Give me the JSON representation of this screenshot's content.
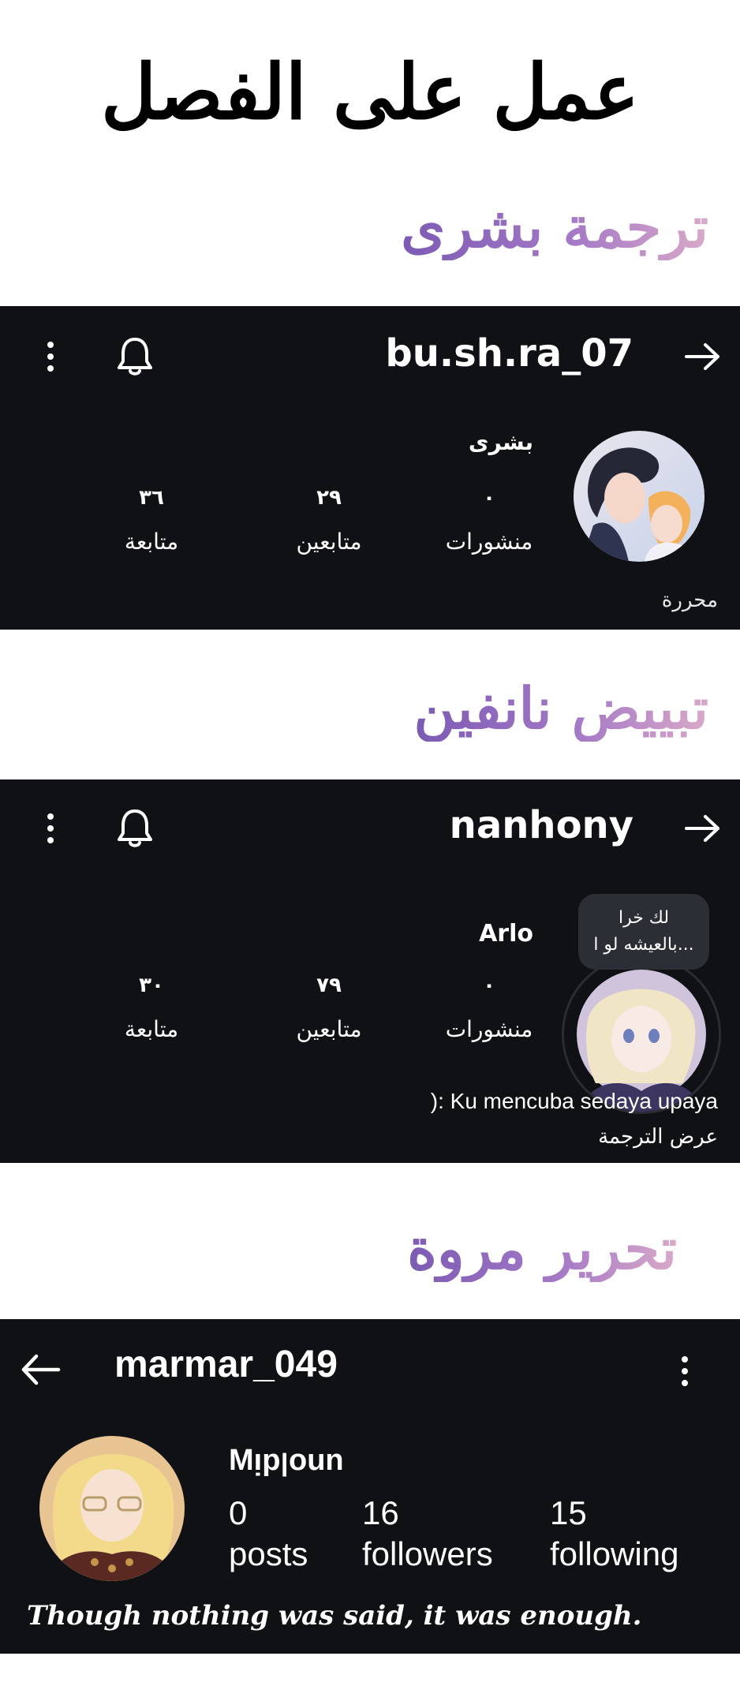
{
  "header": {
    "title": "عمل على الفصل"
  },
  "credits": {
    "translation": "ترجمة بشرى",
    "cleaning": "تبييض نانفين",
    "editing": "تحرير مروة"
  },
  "profile1": {
    "username": "bu.sh.ra_07",
    "display_name": "بشرى",
    "stats": [
      {
        "value": "٠",
        "label": "منشورات"
      },
      {
        "value": "٢٩",
        "label": "متابعين"
      },
      {
        "value": "٣٦",
        "label": "متابعة"
      }
    ],
    "role": "محررة",
    "icons": {
      "back": "arrow-icon",
      "bell": "bell-icon",
      "menu": "more-vertical-icon"
    }
  },
  "profile2": {
    "username": "nanhony",
    "display_name": "Arlo",
    "note_line1": "لك خرا",
    "note_line2": "بالعيشه لو ا...",
    "stats": [
      {
        "value": "٠",
        "label": "منشورات"
      },
      {
        "value": "٧٩",
        "label": "متابعين"
      },
      {
        "value": "٣٠",
        "label": "متابعة"
      }
    ],
    "bio": "): Ku mencuba sedaya upaya",
    "see_translation": "عرض الترجمة"
  },
  "profile3": {
    "username": "marmar_049",
    "display_name": "Mᴉpꞁoun",
    "stats": [
      {
        "value": "0",
        "label": "posts"
      },
      {
        "value": "16",
        "label": "followers"
      },
      {
        "value": "15",
        "label": "following"
      }
    ],
    "quote": "Though nothing was said, it was enough."
  },
  "colors": {
    "panel_bg": "#0f1115",
    "accent_purple": "#7b5bb3",
    "accent_pink": "#d9a9c9"
  }
}
